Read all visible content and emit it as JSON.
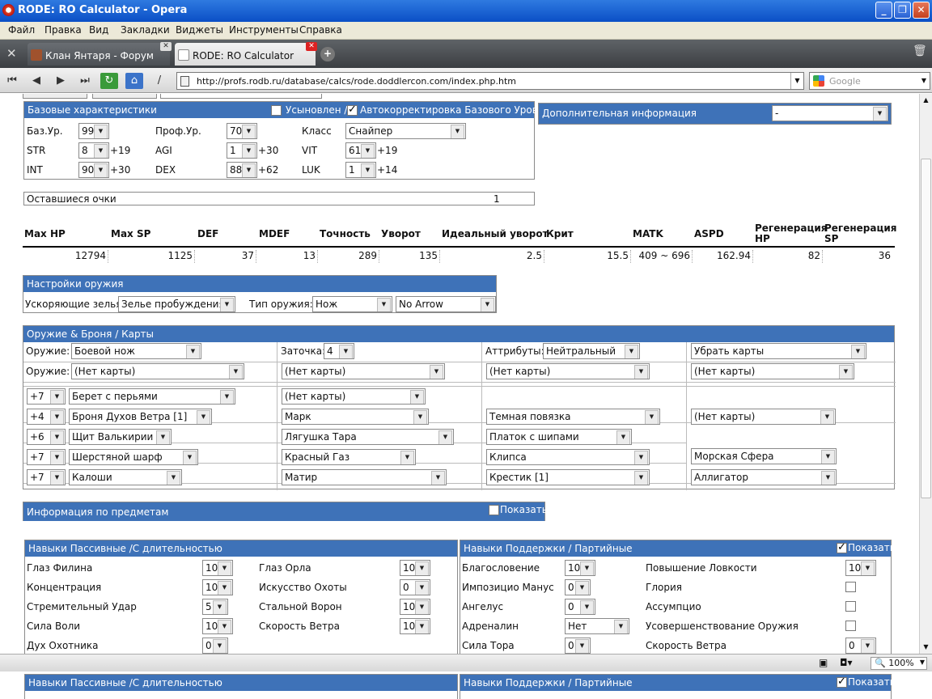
{
  "window": {
    "title": "RODE: RO Calculator - Opera"
  },
  "menu": [
    "Файл",
    "Правка",
    "Вид",
    "Закладки",
    "Виджеты",
    "Инструменты",
    "Справка"
  ],
  "tabs": [
    {
      "label": "Клан Янтаря - Форум"
    },
    {
      "label": "RODE: RO Calculator"
    }
  ],
  "address": {
    "url": "http://profs.rodb.ru/database/calcs/rode.doddlercon.com/index.php.htm",
    "search_placeholder": "Google"
  },
  "status": {
    "zoom": "100%"
  },
  "base_stats": {
    "header": "Базовые характеристики",
    "adopted": "Усыновлен /",
    "autocorrect": "Автокорректировка Базового Уровня",
    "base_lv_label": "Баз.Ур.",
    "base_lv": "99",
    "job_lv_label": "Проф.Ур.",
    "job_lv": "70",
    "class_label": "Класс",
    "class": "Снайпер",
    "str_label": "STR",
    "str": "8",
    "str_bonus": "+19",
    "agi_label": "AGI",
    "agi": "1",
    "agi_bonus": "+30",
    "vit_label": "VIT",
    "vit": "61",
    "vit_bonus": "+19",
    "int_label": "INT",
    "int": "90",
    "int_bonus": "+30",
    "dex_label": "DEX",
    "dex": "88",
    "dex_bonus": "+62",
    "luk_label": "LUK",
    "luk": "1",
    "luk_bonus": "+14"
  },
  "extra_info": {
    "header": "Дополнительная информация",
    "value": "-"
  },
  "remaining": {
    "label": "Оставшиеся очки",
    "value": "1"
  },
  "stats_table": {
    "headers": [
      "Max HP",
      "Max SP",
      "DEF",
      "MDEF",
      "Точность",
      "Уворот",
      "Идеальный уворот",
      "Крит",
      "MATK",
      "ASPD",
      "Регенерация HP",
      "Регенерация SP"
    ],
    "values": [
      "12794",
      "1125",
      "37",
      "13",
      "289",
      "135",
      "2.5",
      "15.5",
      "409 ~ 696",
      "162.94",
      "82",
      "36"
    ]
  },
  "weapon_settings": {
    "header": "Настройки оружия",
    "speed_label": "Ускоряющие зелья:",
    "speed": "Зелье пробуждения",
    "type_label": "Тип оружия:",
    "type": "Нож",
    "arrow": "No Arrow"
  },
  "equipment": {
    "header": "Оружие & Броня / Карты",
    "weapon_label": "Оружие:",
    "weapon": "Боевой нож",
    "refine_label": "Заточка:",
    "refine": "4",
    "attr_label": "Аттрибуты:",
    "attr": "Нейтральный",
    "remove_cards": "Убрать карты",
    "card_label": "Оружие:",
    "cards": [
      "(Нет карты)",
      "(Нет карты)",
      "(Нет карты)",
      "(Нет карты)"
    ],
    "rows": [
      {
        "refine": "+7",
        "item": "Берет с перьями",
        "c1": "(Нет карты)",
        "c2": "",
        "c3": ""
      },
      {
        "refine": "+4",
        "item": "Броня Духов Ветра [1]",
        "c1": "Марк",
        "c2": "Темная повязка",
        "c3": "(Нет карты)"
      },
      {
        "refine": "+6",
        "item": "Щит Валькирии",
        "c1": "Лягушка Тара",
        "c2": "Платок с шипами",
        "c3": ""
      },
      {
        "refine": "+7",
        "item": "Шерстяной шарф",
        "c1": "Красный Газ",
        "c2": "Клипса",
        "c3": "Морская Сфера"
      },
      {
        "refine": "+7",
        "item": "Калоши",
        "c1": "Матир",
        "c2": "Крестик [1]",
        "c3": "Аллигатор"
      }
    ]
  },
  "items_info": {
    "header": "Информация по предметам",
    "show": "Показать"
  },
  "passive": {
    "header": "Навыки Пассивные /С длительностью",
    "left": [
      {
        "name": "Глаз Филина",
        "value": "10"
      },
      {
        "name": "Концентрация",
        "value": "10"
      },
      {
        "name": "Стремительный Удар",
        "value": "5"
      },
      {
        "name": "Сила Воли",
        "value": "10"
      },
      {
        "name": "Дух Охотника",
        "value": "0"
      }
    ],
    "right": [
      {
        "name": "Глаз Орла",
        "value": "10"
      },
      {
        "name": "Искусство Охоты",
        "value": "0"
      },
      {
        "name": "Стальной Ворон",
        "value": "10"
      },
      {
        "name": "Скорость Ветра",
        "value": "10"
      }
    ]
  },
  "support": {
    "header": "Навыки Поддержки / Партийные",
    "show": "Показать",
    "left": [
      {
        "name": "Благословение",
        "value": "10"
      },
      {
        "name": "Импозицио Манус",
        "value": "0"
      },
      {
        "name": "Ангелус",
        "value": "0"
      },
      {
        "name": "Адреналин",
        "value": "Нет"
      },
      {
        "name": "Сила Тора",
        "value": "0"
      }
    ],
    "right": [
      {
        "name": "Повышение Ловкости",
        "value": "10"
      },
      {
        "name": "Глория",
        "value": ""
      },
      {
        "name": "Ассумпцио",
        "value": ""
      },
      {
        "name": "Усовершенствование Оружия",
        "value": ""
      },
      {
        "name": "Скорость Ветра",
        "value": "0"
      }
    ]
  },
  "lower": {
    "passive_header": "Навыки Пассивные /С длительностью",
    "support_header": "Навыки Поддержки / Партийные",
    "show": "Показать"
  }
}
